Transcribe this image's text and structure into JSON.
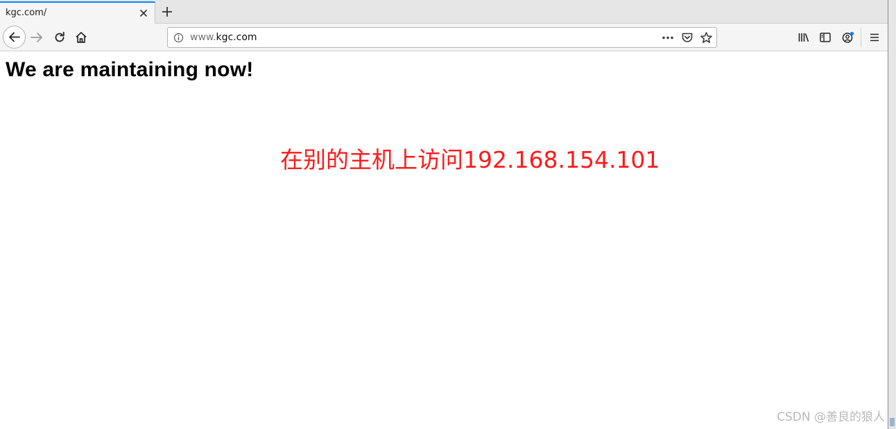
{
  "tab": {
    "title": "kgc.com/"
  },
  "urlbar": {
    "url_prefix": "www.",
    "url_domain": "kgc.com"
  },
  "page": {
    "heading": "We are maintaining now!",
    "notice": "在别的主机上访问192.168.154.101"
  },
  "watermark": "CSDN @善良的狼人",
  "icons": {
    "tab_close": "close-icon",
    "new_tab": "plus-icon",
    "back": "arrow-left-icon",
    "forward": "arrow-right-icon",
    "reload": "reload-icon",
    "home": "home-icon",
    "site_info": "info-icon",
    "page_actions": "more-dots-icon",
    "pocket": "pocket-icon",
    "bookmark": "star-icon",
    "library": "library-icon",
    "sidebar": "sidebar-icon",
    "account": "account-icon",
    "menu": "hamburger-menu-icon"
  },
  "colors": {
    "notice_text": "#ff1a1a",
    "tab_accent": "#0a84ff",
    "watermark": "#b9b9b9"
  }
}
